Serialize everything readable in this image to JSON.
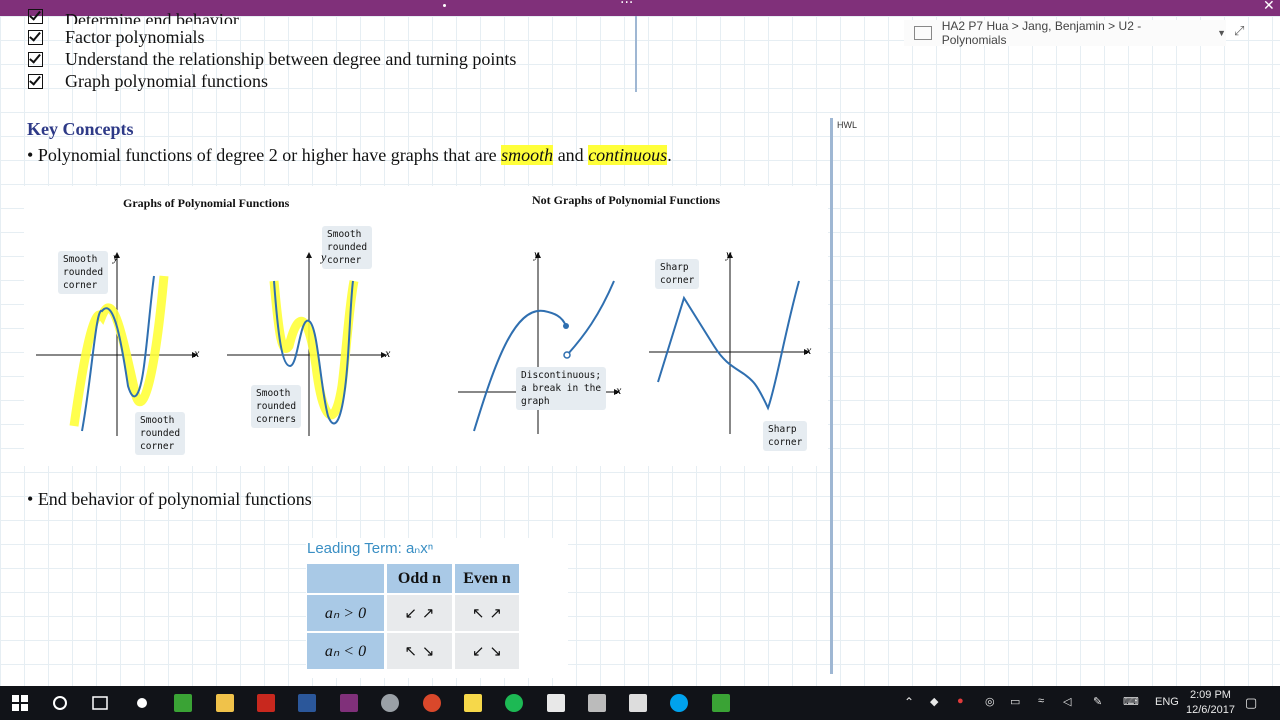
{
  "titlebar": {
    "more_label": "···",
    "close_label": "✕"
  },
  "breadcrumb": {
    "text": "HA2 P7 Hua > Jang, Benjamin > U2 - Polynomials"
  },
  "objectives": [
    "Determine end behavior",
    "Factor polynomials",
    "Understand the relationship between degree and turning points",
    "Graph polynomial functions"
  ],
  "key_concepts": {
    "heading": "Key Concepts",
    "bullet1_pre": "Polynomial functions of degree 2 or higher have graphs that are ",
    "bullet1_smooth": "smooth",
    "bullet1_and": " and ",
    "bullet1_continuous": "continuous",
    "bullet1_end": ".",
    "bullet2": "End behavior of polynomial functions"
  },
  "side_note": "HWL",
  "figure": {
    "left_title": "Graphs of Polynomial Functions",
    "right_title": "Not Graphs of Polynomial Functions",
    "axis_x": "x",
    "axis_y": "y",
    "labels": {
      "smooth_corner_a": "Smooth\nrounded\ncorner",
      "smooth_corner_b": "Smooth\nrounded\ncorner",
      "smooth_corner_c": "Smooth\nrounded\ncorner",
      "smooth_corners": "Smooth\nrounded\ncorners",
      "discontinuous": "Discontinuous;\na break in the\ngraph",
      "sharp_corner_a": "Sharp\ncorner",
      "sharp_corner_b": "Sharp\ncorner"
    }
  },
  "leading_term": {
    "title": "Leading Term: aₙxⁿ",
    "col_odd": "Odd n",
    "col_even": "Even n",
    "row_pos": "aₙ > 0",
    "row_neg": "aₙ < 0",
    "pos_odd": "↙ ↗",
    "pos_even": "↖ ↗",
    "neg_odd": "↖ ↘",
    "neg_even": "↙ ↘"
  },
  "taskbar": {
    "lang": "ENG",
    "time": "2:09 PM",
    "date": "12/6/2017"
  },
  "colors": {
    "titlebar": "#80307a",
    "heading": "#2e3a87",
    "highlight": "#ffff3a",
    "curve": "#2f6fb0"
  }
}
